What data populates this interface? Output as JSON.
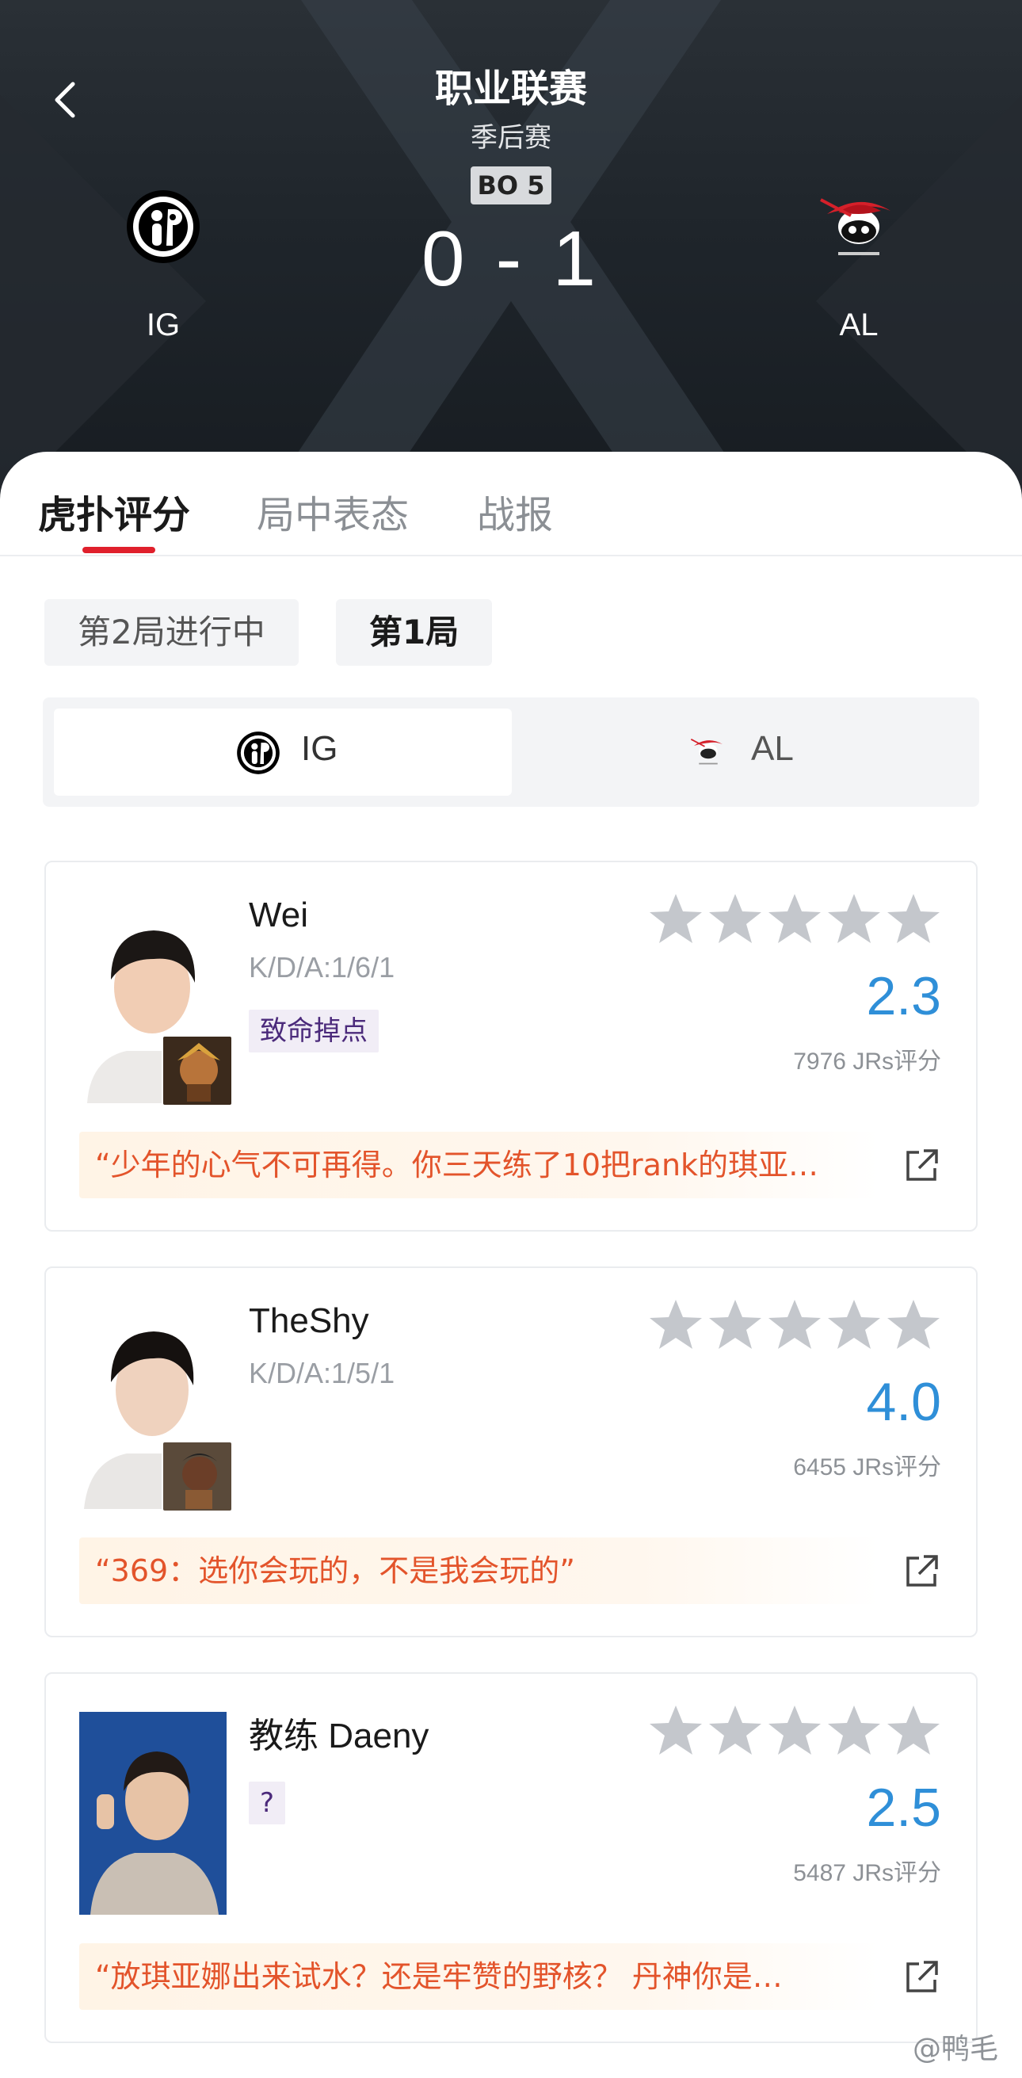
{
  "header": {
    "title": "职业联赛",
    "subtitle": "季后赛",
    "best_of": "BO 5",
    "score": "0 - 1",
    "team_left": "IG",
    "team_right": "AL"
  },
  "tabs": [
    {
      "label": "虎扑评分",
      "active": true
    },
    {
      "label": "局中表态",
      "active": false
    },
    {
      "label": "战报",
      "active": false
    }
  ],
  "rounds": [
    {
      "label": "第2局进行中",
      "active": false
    },
    {
      "label": "第1局",
      "active": true
    }
  ],
  "team_switch": [
    {
      "label": "IG",
      "active": true
    },
    {
      "label": "AL",
      "active": false
    }
  ],
  "players": [
    {
      "name": "Wei",
      "kda": "K/D/A:1/6/1",
      "tag": "致命掉点",
      "rating": "2.3",
      "votes": "7976 JRs评分",
      "quote": "“少年的心气不可再得。你三天练了10把rank的琪亚…"
    },
    {
      "name": "TheShy",
      "kda": "K/D/A:1/5/1",
      "tag": "",
      "rating": "4.0",
      "votes": "6455 JRs评分",
      "quote": "“369：选你会玩的，不是我会玩的”"
    },
    {
      "name": "教练 Daeny",
      "kda": "",
      "tag": "?",
      "rating": "2.5",
      "votes": "5487 JRs评分",
      "quote": "“放琪亚娜出来试水？还是牢赞的野核？ 丹神你是…"
    }
  ],
  "watermark": "@鸭毛",
  "colors": {
    "accent_red": "#e0202c",
    "rating_blue": "#2f8fd8",
    "quote_orange": "#e3542b",
    "star_grey": "#c4c7cc"
  },
  "icons": {
    "back": "chevron-left-icon",
    "share": "share-external-icon",
    "star": "star-icon"
  }
}
